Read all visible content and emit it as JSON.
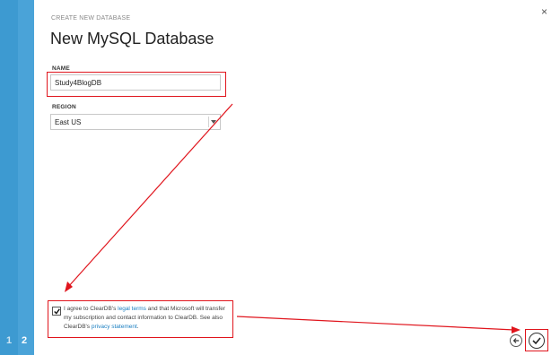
{
  "steps": [
    "1",
    "2"
  ],
  "close_glyph": "×",
  "header": {
    "eyebrow": "CREATE NEW DATABASE",
    "title": "New MySQL Database"
  },
  "form": {
    "name_label": "NAME",
    "name_value": "Study4BlogDB",
    "region_label": "REGION",
    "region_value": "East US"
  },
  "consent": {
    "checked": true,
    "text_1": "I agree to ClearDB's ",
    "legal_link": "legal terms",
    "text_2": " and that Microsoft will transfer my subscription and contact information to ClearDB. See also ClearDB's ",
    "privacy_link": "privacy statement",
    "text_3": "."
  },
  "colors": {
    "rail": "#4aa3d8",
    "annotation": "#e0151d",
    "link": "#1a7ec1"
  }
}
